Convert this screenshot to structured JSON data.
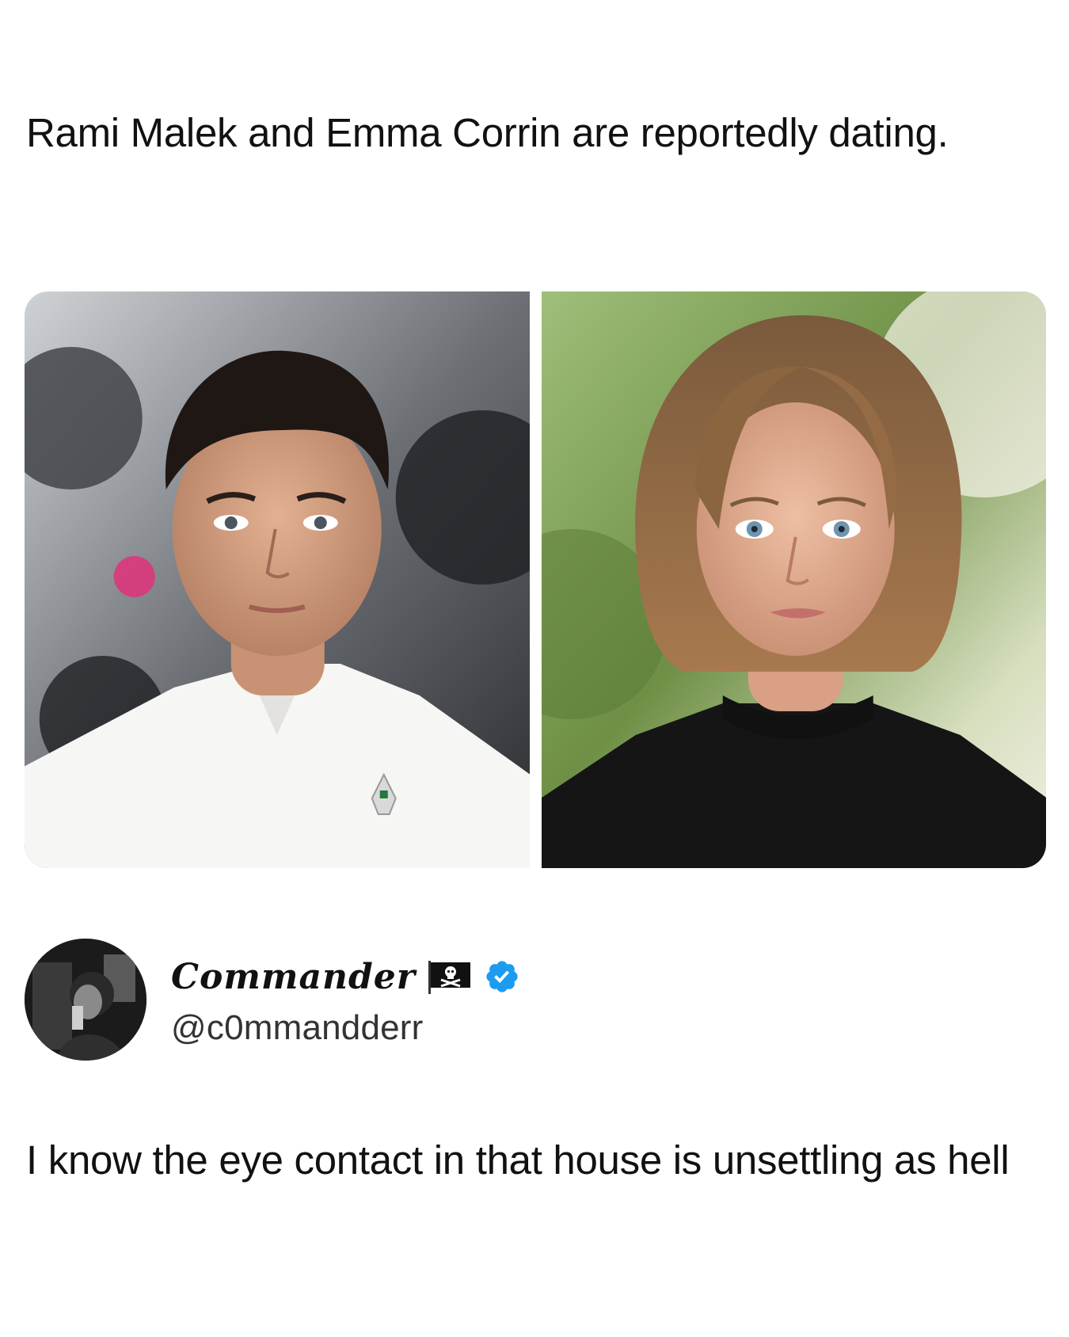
{
  "quoted_post": {
    "text": "Rami Malek and Emma Corrin are reportedly dating."
  },
  "media": {
    "images": [
      {
        "name": "photo-man-white-shirt"
      },
      {
        "name": "photo-woman-black-top"
      }
    ]
  },
  "author": {
    "display_name": "Commander",
    "handle": "@c0mmandderr",
    "flag_icon": "pirate-flag-icon",
    "verified_icon": "verified-badge-icon",
    "verified_color": "#1d9bf0"
  },
  "post": {
    "text": "I know the eye contact in that house is unsettling as hell"
  }
}
